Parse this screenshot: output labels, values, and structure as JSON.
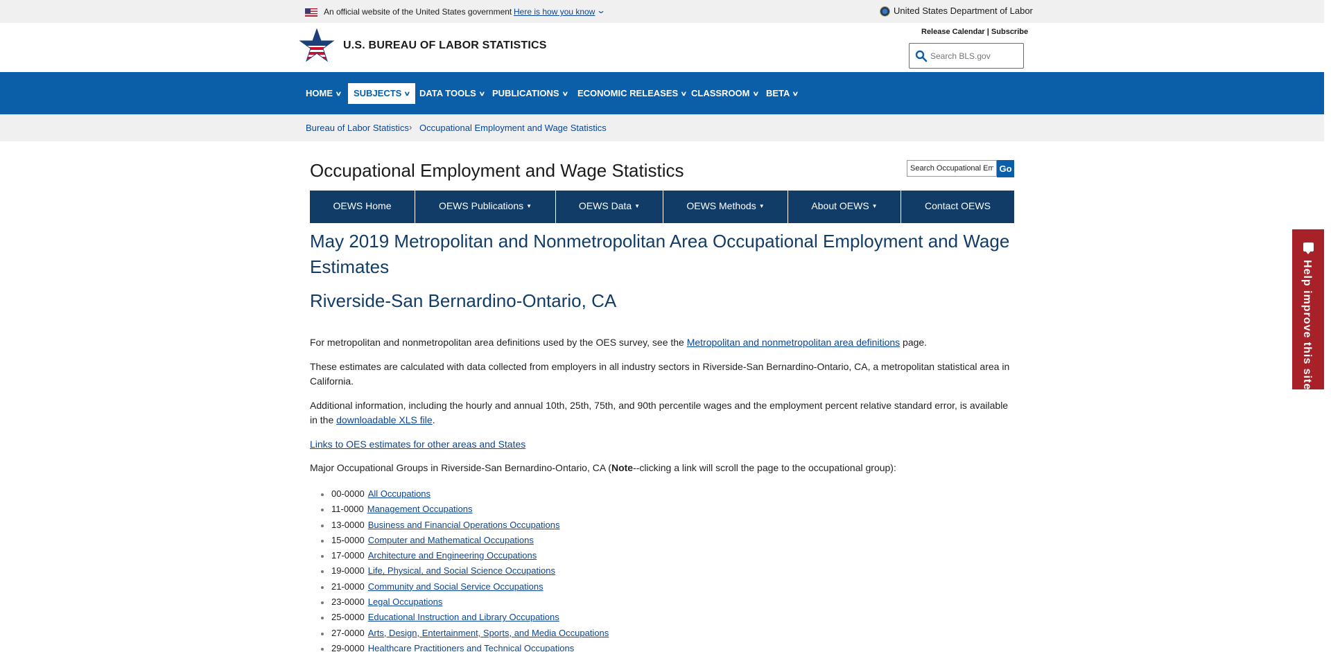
{
  "gov_banner": {
    "official_text": "An official website of the United States government",
    "how_link": "Here is how you know",
    "department": "United States Department of Labor"
  },
  "header": {
    "site_title": "U.S. BUREAU OF LABOR STATISTICS",
    "release_calendar": "Release Calendar",
    "separator": "|",
    "subscribe": "Subscribe",
    "search_placeholder": "Search BLS.gov"
  },
  "main_nav": [
    {
      "label": "HOME",
      "active": false
    },
    {
      "label": "SUBJECTS",
      "active": true
    },
    {
      "label": "DATA TOOLS",
      "active": false
    },
    {
      "label": "PUBLICATIONS",
      "active": false
    },
    {
      "label": "ECONOMIC RELEASES",
      "active": false
    },
    {
      "label": "CLASSROOM",
      "active": false
    },
    {
      "label": "BETA",
      "active": false
    }
  ],
  "breadcrumb": {
    "home": "Bureau of Labor Statistics",
    "current": "Occupational Employment and Wage Statistics"
  },
  "program": {
    "title": "Occupational Employment and Wage Statistics",
    "search_value": "Search Occupational Em",
    "go_label": "Go"
  },
  "sub_nav": [
    {
      "label": "OEWS Home",
      "dropdown": false
    },
    {
      "label": "OEWS Publications",
      "dropdown": true
    },
    {
      "label": "OEWS Data",
      "dropdown": true
    },
    {
      "label": "OEWS Methods",
      "dropdown": true
    },
    {
      "label": "About OEWS",
      "dropdown": true
    },
    {
      "label": "Contact OEWS",
      "dropdown": false
    }
  ],
  "content": {
    "heading": "May 2019 Metropolitan and Nonmetropolitan Area Occupational Employment and Wage Estimates",
    "area": "Riverside-San Bernardino-Ontario, CA",
    "p1_before": "For metropolitan and nonmetropolitan area definitions used by the OES survey, see the ",
    "p1_link": "Metropolitan and nonmetropolitan area definitions",
    "p1_after": " page.",
    "p2": "These estimates are calculated with data collected from employers in all industry sectors in Riverside-San Bernardino-Ontario, CA, a metropolitan statistical area in California.",
    "p3_before": "Additional information, including the hourly and annual 10th, 25th, 75th, and 90th percentile wages and the employment percent relative standard error, is available in the ",
    "p3_link": "downloadable XLS file",
    "p3_after": ".",
    "other_areas_link": "Links to OES estimates for other areas and States",
    "groups_intro_before": "Major Occupational Groups in Riverside-San Bernardino-Ontario, CA (",
    "groups_intro_note": "Note",
    "groups_intro_after": "--clicking a link will scroll the page to the occupational group):"
  },
  "occupations": [
    {
      "code": "00-0000",
      "name": "All Occupations"
    },
    {
      "code": "11-0000",
      "name": "Management Occupations"
    },
    {
      "code": "13-0000",
      "name": "Business and Financial Operations Occupations"
    },
    {
      "code": "15-0000",
      "name": "Computer and Mathematical Occupations"
    },
    {
      "code": "17-0000",
      "name": "Architecture and Engineering Occupations"
    },
    {
      "code": "19-0000",
      "name": "Life, Physical, and Social Science Occupations"
    },
    {
      "code": "21-0000",
      "name": "Community and Social Service Occupations"
    },
    {
      "code": "23-0000",
      "name": "Legal Occupations"
    },
    {
      "code": "25-0000",
      "name": "Educational Instruction and Library Occupations"
    },
    {
      "code": "27-0000",
      "name": "Arts, Design, Entertainment, Sports, and Media Occupations"
    },
    {
      "code": "29-0000",
      "name": "Healthcare Practitioners and Technical Occupations"
    }
  ],
  "feedback": {
    "label": "Help improve this site"
  },
  "colors": {
    "nav_blue": "#0b5ea8",
    "subnav_navy": "#113c67",
    "feedback_red": "#a72128",
    "link_blue": "#0a4595"
  }
}
